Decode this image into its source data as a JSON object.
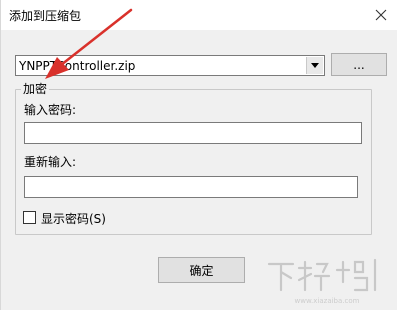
{
  "window": {
    "title": "添加到压缩包"
  },
  "archive": {
    "filename": "YNPPTController.zip",
    "browse_label": "..."
  },
  "encryption": {
    "group_label": "加密",
    "password_label": "输入密码:",
    "password_value": "",
    "reenter_label": "重新输入:",
    "reenter_value": "",
    "show_password_label": "显示密码(S)",
    "show_password_checked": false
  },
  "actions": {
    "ok_label": "确定"
  },
  "annotation": {
    "arrow_color": "#d9312b"
  },
  "watermark": {
    "text": "下载吧",
    "url_text": "www.xiazaiba.com"
  }
}
